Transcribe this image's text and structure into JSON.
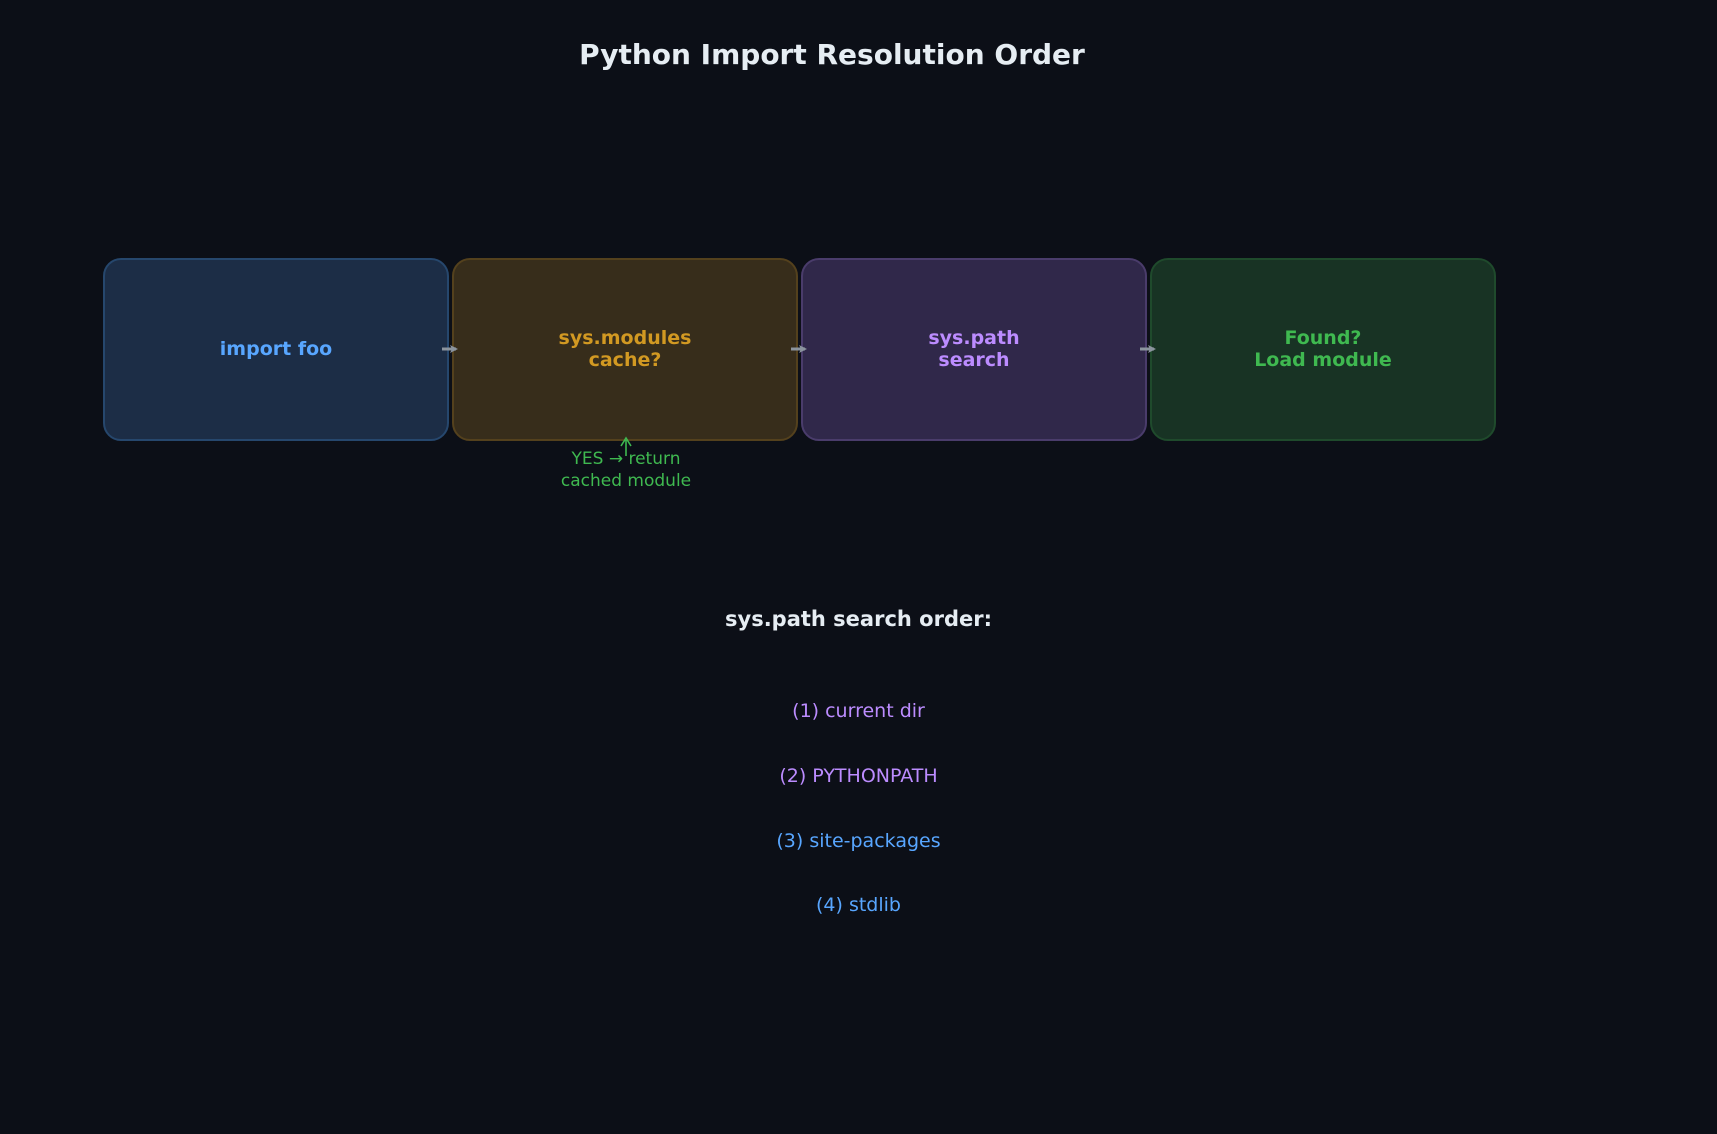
{
  "title": "Python Import Resolution Order",
  "flow": {
    "steps": [
      {
        "label": "import foo",
        "color": "#58a6ff"
      },
      {
        "label": "sys.modules\ncache?",
        "color": "#d29922"
      },
      {
        "label": "sys.path\nsearch",
        "color": "#bc8cff"
      },
      {
        "label": "Found?\nLoad module",
        "color": "#3fb950"
      }
    ],
    "cache_hit_note": "YES → return\ncached module"
  },
  "search_order": {
    "title": "sys.path search order:",
    "items": [
      "(1) current dir",
      "(2) PYTHONPATH",
      "(3) site-packages",
      "(4) stdlib"
    ]
  },
  "colors": {
    "background": "#0c0f17",
    "arrow": "#8b949e",
    "yes_arrow": "#3fb950"
  }
}
